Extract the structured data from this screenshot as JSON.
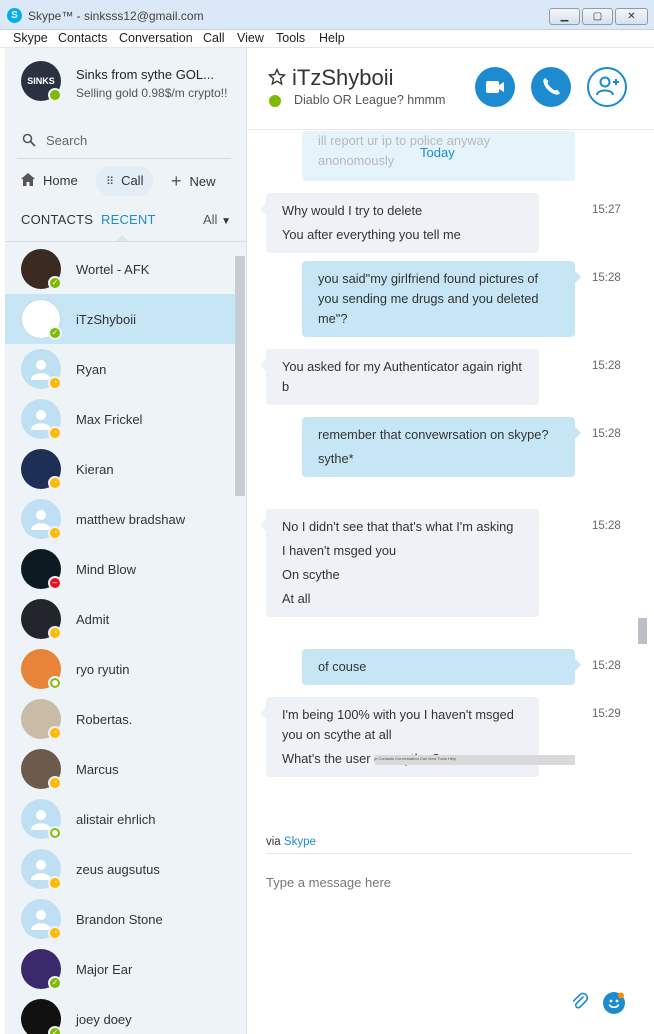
{
  "window": {
    "title": "Skype™ - sinksss12@gmail.com",
    "app_icon": "S",
    "minimize": "▁",
    "maximize": "▢",
    "close": "✕"
  },
  "menu": [
    "Skype",
    "Contacts",
    "Conversation",
    "Call",
    "View",
    "Tools",
    "Help"
  ],
  "profile": {
    "avatar_text": "SINKS",
    "name": "Sinks from sythe GOL...",
    "mood": "Selling gold 0.98$/m crypto!!"
  },
  "search": {
    "placeholder": "Search"
  },
  "nav": {
    "home": "Home",
    "call": "Call",
    "new": "New"
  },
  "tabs": {
    "contacts": "CONTACTS",
    "recent": "RECENT",
    "filter": "All"
  },
  "contacts": [
    {
      "name": "Wortel - AFK",
      "status": "online",
      "avatar": "photo",
      "color": "#3a2a22"
    },
    {
      "name": "iTzShyboii",
      "status": "online",
      "avatar": "photo",
      "color": "#ffffff",
      "active": true
    },
    {
      "name": "Ryan",
      "status": "away",
      "avatar": "default"
    },
    {
      "name": "Max Frickel",
      "status": "away",
      "avatar": "default"
    },
    {
      "name": "Kieran",
      "status": "away",
      "avatar": "photo",
      "color": "#1d2f55"
    },
    {
      "name": "matthew bradshaw",
      "status": "away",
      "avatar": "default"
    },
    {
      "name": "Mind Blow",
      "status": "dnd",
      "avatar": "photo",
      "color": "#0e1a22"
    },
    {
      "name": "Admit",
      "status": "away",
      "avatar": "photo",
      "color": "#22262c"
    },
    {
      "name": "ryo ryutin",
      "status": "offline",
      "avatar": "photo",
      "color": "#e8843a"
    },
    {
      "name": "Robertas.",
      "status": "away",
      "avatar": "photo",
      "color": "#c9bba6"
    },
    {
      "name": "Marcus",
      "status": "away",
      "avatar": "photo",
      "color": "#6d5a4c"
    },
    {
      "name": "alistair ehrlich",
      "status": "offline",
      "avatar": "default"
    },
    {
      "name": "zeus augsutus",
      "status": "away",
      "avatar": "default"
    },
    {
      "name": "Brandon Stone",
      "status": "away",
      "avatar": "default"
    },
    {
      "name": "Major Ear",
      "status": "online",
      "avatar": "photo",
      "color": "#3b2a6b"
    },
    {
      "name": "joey doey",
      "status": "online",
      "avatar": "photo",
      "color": "#111111"
    }
  ],
  "chat": {
    "title": "iTzShyboii",
    "mood": "Diablo OR League? hmmm",
    "today": "Today",
    "faded_lines": [
      "ill report ur ip to police anyway",
      "anonomously"
    ],
    "messages": [
      {
        "dir": "in",
        "lines": [
          "Why would I try to delete",
          "You after everything you tell me"
        ],
        "time": "15:27"
      },
      {
        "dir": "out",
        "lines": [
          "you said\"my girlfriend found pictures of you sending me drugs and you deleted me\"?"
        ],
        "time": "15:28"
      },
      {
        "dir": "in",
        "lines": [
          "You asked for my Authenticator again right b"
        ],
        "time": "15:28"
      },
      {
        "dir": "out",
        "lines": [
          "remember that convewrsation on skype?",
          "sythe*"
        ],
        "time": "15:28"
      },
      {
        "dir": "in",
        "lines": [
          "No I didn't see that that's what I'm asking",
          "I haven't msged you",
          "On scythe",
          "At all"
        ],
        "time": "15:28"
      },
      {
        "dir": "out",
        "lines": [
          "of couse"
        ],
        "time": "15:28"
      },
      {
        "dir": "in",
        "lines": [
          "I'm being 100% with you I haven't msged you on scythe at all",
          "What's the user on scythe ?"
        ],
        "time": "15:29"
      }
    ],
    "thumb_text": "e   Contacts   Conversation   Call   View   Tools   Help",
    "via": "via",
    "via_brand": "Skype",
    "compose_placeholder": "Type a message here"
  },
  "colors": {
    "accent": "#1c8bd0",
    "online": "#7fba00",
    "away": "#ffb900",
    "dnd": "#e81123",
    "selected": "#c6e6f6"
  }
}
